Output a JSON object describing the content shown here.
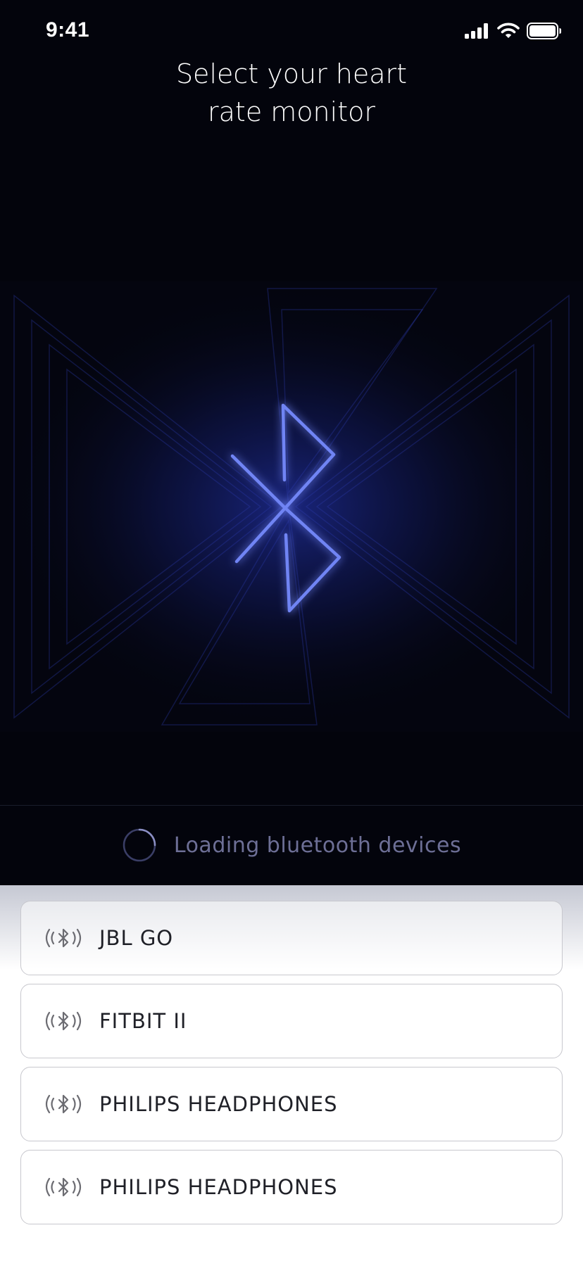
{
  "status_bar": {
    "time": "9:41"
  },
  "header": {
    "title_line1": "Select your heart",
    "title_line2": "rate monitor"
  },
  "loading": {
    "text": "Loading bluetooth devices"
  },
  "devices": [
    {
      "name": "JBL GO"
    },
    {
      "name": "FITBIT II"
    },
    {
      "name": "PHILIPS HEADPHONES"
    },
    {
      "name": "PHILIPS HEADPHONES"
    }
  ],
  "colors": {
    "background_dark": "#03040c",
    "accent_blue": "#6f84f4",
    "loading_text": "#6d6f96",
    "card_border": "#c8c8ce"
  }
}
